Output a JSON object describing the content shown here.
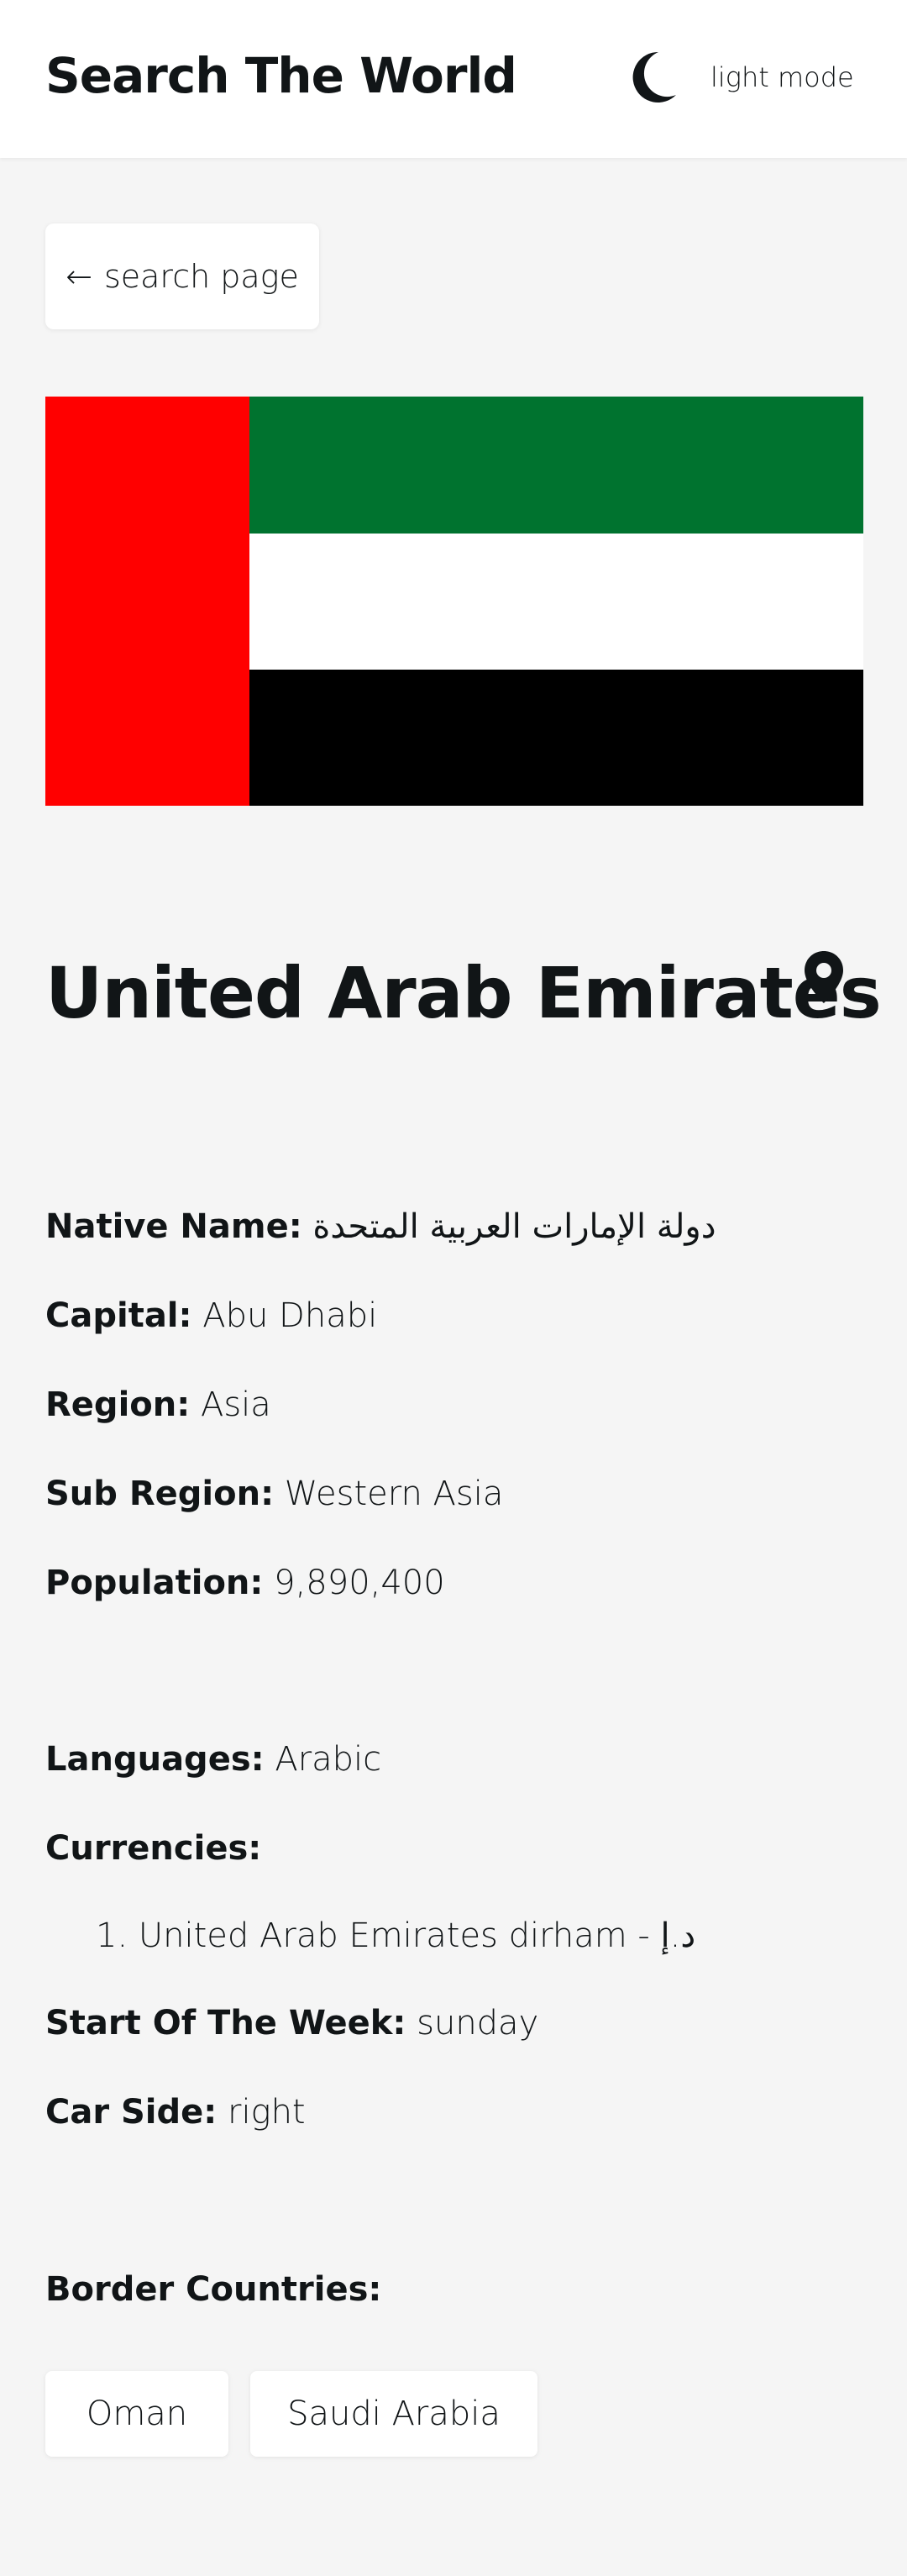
{
  "header": {
    "title": "Search The World",
    "mode_label": "light mode"
  },
  "back": {
    "arrow": "←",
    "label": "search page"
  },
  "country": {
    "name": "United Arab Emirates"
  },
  "details": {
    "native_name": {
      "label": "Native Name:",
      "value": "دولة الإمارات العربية المتحدة"
    },
    "capital": {
      "label": "Capital:",
      "value": "Abu Dhabi"
    },
    "region": {
      "label": "Region:",
      "value": "Asia"
    },
    "sub_region": {
      "label": "Sub Region:",
      "value": "Western Asia"
    },
    "population": {
      "label": "Population:",
      "value": "9,890,400"
    }
  },
  "extra": {
    "languages": {
      "label": "Languages:",
      "value": "Arabic"
    },
    "currencies": {
      "label": "Currencies:",
      "items": [
        "1. United Arab Emirates dirham - د.إ"
      ]
    },
    "start_of_week": {
      "label": "Start Of The Week:",
      "value": "sunday"
    },
    "car_side": {
      "label": "Car Side:",
      "value": "right"
    }
  },
  "borders": {
    "label": "Border Countries:",
    "countries": [
      "Oman",
      "Saudi Arabia"
    ]
  },
  "icons": {
    "mode": "moon-icon",
    "location": "map-pin-icon",
    "back": "arrow-left-icon"
  },
  "colors": {
    "background": "#f5f5f5",
    "surface": "#ffffff",
    "text": "#111517",
    "flag_green": "#00732f",
    "flag_white": "#ffffff",
    "flag_black": "#000000",
    "flag_red": "#ff0000"
  }
}
